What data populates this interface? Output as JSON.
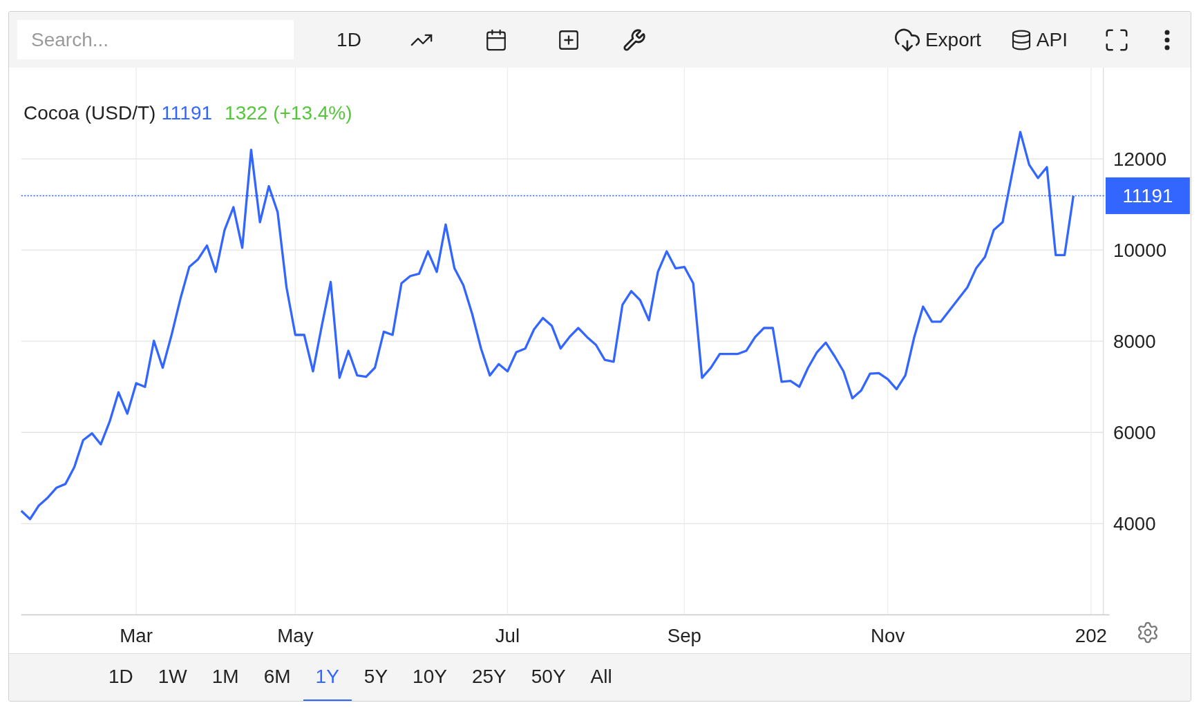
{
  "toolbar": {
    "search": {
      "placeholder": "Search..."
    },
    "interval": "1D",
    "export": "Export",
    "api": "API"
  },
  "legend": {
    "price": "11191",
    "change": "1322 (+13.4%)"
  },
  "chart_data": {
    "type": "line",
    "grid": true,
    "ref_lines": [
      {
        "axis": "y",
        "value": 11191,
        "label": "11191",
        "color": "#3366ff"
      }
    ],
    "ylim": [
      2000,
      14000
    ],
    "categories": [
      null,
      null,
      null,
      null,
      null,
      null,
      null,
      null,
      null,
      null,
      null,
      null,
      null,
      "Mar",
      null,
      null,
      null,
      null,
      null,
      null,
      null,
      null,
      null,
      null,
      null,
      null,
      null,
      null,
      null,
      null,
      null,
      "May",
      null,
      null,
      null,
      null,
      null,
      null,
      null,
      null,
      null,
      null,
      null,
      null,
      null,
      null,
      null,
      null,
      null,
      null,
      null,
      null,
      null,
      null,
      null,
      "Jul",
      null,
      null,
      null,
      null,
      null,
      null,
      null,
      null,
      null,
      null,
      null,
      null,
      null,
      null,
      null,
      null,
      null,
      null,
      null,
      "Sep",
      null,
      null,
      null,
      null,
      null,
      null,
      null,
      null,
      null,
      null,
      null,
      null,
      null,
      null,
      null,
      null,
      null,
      null,
      null,
      null,
      null,
      null,
      "Nov",
      null,
      null,
      null,
      null,
      null,
      null,
      null,
      null,
      null,
      null,
      null,
      null,
      null,
      null,
      null,
      null,
      null,
      null,
      null,
      null,
      null,
      null,
      "202"
    ],
    "yticks": [
      4000,
      6000,
      8000,
      10000,
      12000
    ],
    "series": [
      {
        "name": "Cocoa (USD/T)",
        "color": "#3366ff",
        "values": [
          4280,
          4100,
          4400,
          4570,
          4790,
          4870,
          5240,
          5830,
          5980,
          5740,
          6240,
          6880,
          6410,
          7080,
          7000,
          8010,
          7420,
          8140,
          8930,
          9630,
          9800,
          10100,
          9520,
          10440,
          10940,
          10050,
          12200,
          10610,
          11400,
          10830,
          9180,
          8140,
          8140,
          7340,
          8340,
          9300,
          7200,
          7790,
          7250,
          7220,
          7420,
          8210,
          8140,
          9270,
          9430,
          9480,
          9970,
          9520,
          10560,
          9600,
          9230,
          8600,
          7840,
          7250,
          7500,
          7340,
          7760,
          7840,
          8260,
          8510,
          8340,
          7840,
          8090,
          8290,
          8090,
          7920,
          7590,
          7550,
          8800,
          9100,
          8900,
          8460,
          9520,
          9970,
          9600,
          9630,
          9270,
          7200,
          7420,
          7720,
          7720,
          7720,
          7790,
          8090,
          8290,
          8290,
          7110,
          7130,
          7000,
          7420,
          7760,
          7970,
          7670,
          7340,
          6750,
          6920,
          7290,
          7300,
          7170,
          6950,
          7250,
          8090,
          8760,
          8430,
          8430,
          8680,
          8930,
          9180,
          9600,
          9850,
          10440,
          10610,
          11610,
          12590,
          11870,
          11580,
          11820,
          9890,
          9890,
          11190,
          null,
          null
        ]
      }
    ]
  },
  "ranges": [
    {
      "label": "1D",
      "selected": false
    },
    {
      "label": "1W",
      "selected": false
    },
    {
      "label": "1M",
      "selected": false
    },
    {
      "label": "6M",
      "selected": false
    },
    {
      "label": "1Y",
      "selected": true
    },
    {
      "label": "5Y",
      "selected": false
    },
    {
      "label": "10Y",
      "selected": false
    },
    {
      "label": "25Y",
      "selected": false
    },
    {
      "label": "50Y",
      "selected": false
    },
    {
      "label": "All",
      "selected": false
    }
  ]
}
